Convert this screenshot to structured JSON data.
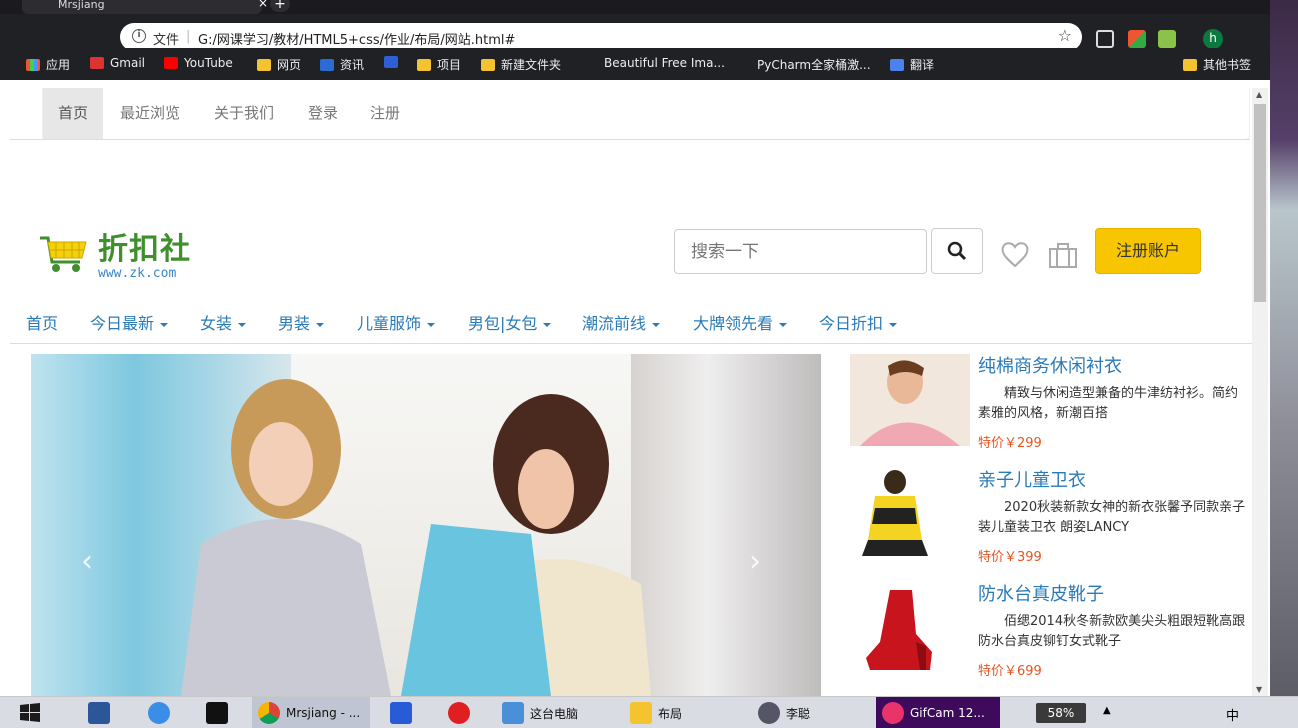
{
  "browser": {
    "tab_title": "Mrsjiang",
    "tab_close": "×",
    "new_tab": "+",
    "address_label": "文件",
    "address_sep": "|",
    "url": "G:/网课学习/教材/HTML5+css/作业/布局/网站.html#",
    "star": "☆",
    "profile_initial": "h",
    "bookmarks": [
      {
        "label": "应用",
        "icon": "apps-grid-icon"
      },
      {
        "label": "Gmail",
        "icon": "gmail-icon"
      },
      {
        "label": "YouTube",
        "icon": "youtube-icon"
      },
      {
        "label": "网页",
        "icon": "folder-icon"
      },
      {
        "label": "资讯",
        "icon": "news-icon"
      },
      {
        "label": "",
        "icon": "baidu-icon"
      },
      {
        "label": "项目",
        "icon": "folder-icon"
      },
      {
        "label": "新建文件夹",
        "icon": "folder-icon"
      },
      {
        "label": "Beautiful Free Ima...",
        "icon": "page-icon"
      },
      {
        "label": "PyCharm全家桶激...",
        "icon": "page-icon"
      },
      {
        "label": "翻译",
        "icon": "translate-icon"
      },
      {
        "label": "其他书签",
        "icon": "folder-icon"
      }
    ]
  },
  "page": {
    "top_nav": [
      "首页",
      "最近浏览",
      "关于我们",
      "登录",
      "注册"
    ],
    "logo_title": "折扣社",
    "logo_sub": "www.zk.com",
    "search_placeholder": "搜索一下",
    "register_button": "注册账户",
    "categories": [
      "首页",
      "今日最新",
      "女装",
      "男装",
      "儿童服饰",
      "男包|女包",
      "潮流前线",
      "大牌领先看",
      "今日折扣"
    ],
    "carousel_prev": "‹",
    "carousel_next": "›",
    "products": [
      {
        "name": "纯棉商务休闲衬衣",
        "desc": "精致与休闲造型兼备的牛津纺衬衫。简约素雅的风格，新潮百搭",
        "price": "特价￥299"
      },
      {
        "name": "亲子儿童卫衣",
        "desc": "2020秋装新款女神的新衣张馨予同款亲子装儿童装卫衣 朗姿LANCY",
        "price": "特价￥399"
      },
      {
        "name": "防水台真皮靴子",
        "desc": "佰缌2014秋冬新款欧美尖头粗跟短靴高跟 防水台真皮铆钉女式靴子",
        "price": "特价￥699"
      }
    ]
  },
  "taskbar": {
    "items": [
      {
        "label": "",
        "icon": "windows-start-icon"
      },
      {
        "label": "",
        "icon": "word-icon"
      },
      {
        "label": "",
        "icon": "baidu-netdisk-icon"
      },
      {
        "label": "",
        "icon": "webstorm-icon"
      },
      {
        "label": "Mrsjiang - ...",
        "icon": "chrome-icon"
      },
      {
        "label": "",
        "icon": "mcafee-icon"
      },
      {
        "label": "",
        "icon": "netease-music-icon"
      },
      {
        "label": "这台电脑",
        "icon": "computer-icon"
      },
      {
        "label": "布局",
        "icon": "folder-icon"
      },
      {
        "label": "李聪",
        "icon": "avatar-icon"
      },
      {
        "label": "GifCam 12...",
        "icon": "gifcam-icon"
      }
    ],
    "battery": "58%",
    "ime": "中"
  }
}
